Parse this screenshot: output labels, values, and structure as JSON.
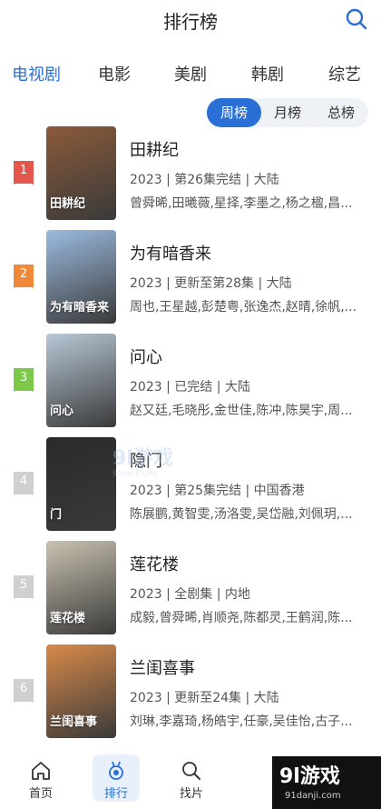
{
  "header": {
    "title": "排行榜",
    "search_icon": "search-icon"
  },
  "category_tabs": [
    {
      "label": "电视剧",
      "active": true
    },
    {
      "label": "电影",
      "active": false
    },
    {
      "label": "美剧",
      "active": false
    },
    {
      "label": "韩剧",
      "active": false
    },
    {
      "label": "综艺",
      "active": false
    }
  ],
  "period_tabs": [
    {
      "label": "周榜",
      "active": true
    },
    {
      "label": "月榜",
      "active": false
    },
    {
      "label": "总榜",
      "active": false
    }
  ],
  "rank_colors": [
    "#e2564b",
    "#f0883a",
    "#7cc94a",
    "#d0d0d0",
    "#d0d0d0",
    "#d0d0d0"
  ],
  "items": [
    {
      "rank": "1",
      "title": "田耕纪",
      "meta": "2023 | 第26集完结 | 大陆",
      "cast": "曾舜晞,田曦薇,星择,李墨之,杨之楹,昌...",
      "poster_text": "田耕纪",
      "poster_color": "#8a5a3a"
    },
    {
      "rank": "2",
      "title": "为有暗香来",
      "meta": "2023 | 更新至第28集 | 大陆",
      "cast": "周也,王星越,彭楚粤,张逸杰,赵晴,徐帆,...",
      "poster_text": "为有暗香来",
      "poster_color": "#9cbbe0"
    },
    {
      "rank": "3",
      "title": "问心",
      "meta": "2023 | 已完结 | 大陆",
      "cast": "赵又廷,毛晓彤,金世佳,陈冲,陈昊宇,周...",
      "poster_text": "问心",
      "poster_color": "#b8c8d6"
    },
    {
      "rank": "4",
      "title": "隐门",
      "meta": "2023 | 第25集完结 | 中国香港",
      "cast": "陈展鹏,黄智雯,汤洛雯,吴岱融,刘佩玥,...",
      "poster_text": "门",
      "poster_color": "#2a2a2a"
    },
    {
      "rank": "5",
      "title": "莲花楼",
      "meta": "2023 | 全剧集 | 内地",
      "cast": "成毅,曾舜晞,肖顺尧,陈都灵,王鹤润,陈...",
      "poster_text": "莲花楼",
      "poster_color": "#c9c2b0"
    },
    {
      "rank": "6",
      "title": "兰闺喜事",
      "meta": "2023 | 更新至24集 | 大陆",
      "cast": "刘琳,李嘉琦,杨皓宇,任豪,吴佳怡,古子...",
      "poster_text": "兰闺喜事",
      "poster_color": "#d98a4a"
    }
  ],
  "bottom_nav": [
    {
      "label": "首页",
      "icon": "home-icon",
      "active": false
    },
    {
      "label": "排行",
      "icon": "medal-icon",
      "active": true
    },
    {
      "label": "找片",
      "icon": "search-icon",
      "active": false
    }
  ],
  "watermark": {
    "big": "9l游戏",
    "small": "91danji.com"
  },
  "overlay_mark": {
    "big": "9l游戏",
    "small": "91danji.com"
  },
  "accent_color": "#2a6fd6"
}
